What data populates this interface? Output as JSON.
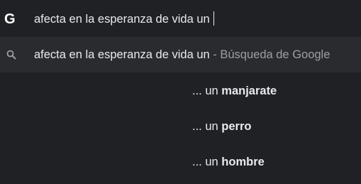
{
  "omnibox": {
    "query": "afecta en la esperanza de vida un"
  },
  "suggestions": {
    "first": {
      "text": "afecta en la esperanza de vida un",
      "separator": " - ",
      "provider": "Búsqueda de Google"
    },
    "tails": [
      {
        "prefix": "... un ",
        "completion": "manjarate"
      },
      {
        "prefix": "... un ",
        "completion": "perro"
      },
      {
        "prefix": "... un ",
        "completion": "hombre"
      }
    ]
  }
}
